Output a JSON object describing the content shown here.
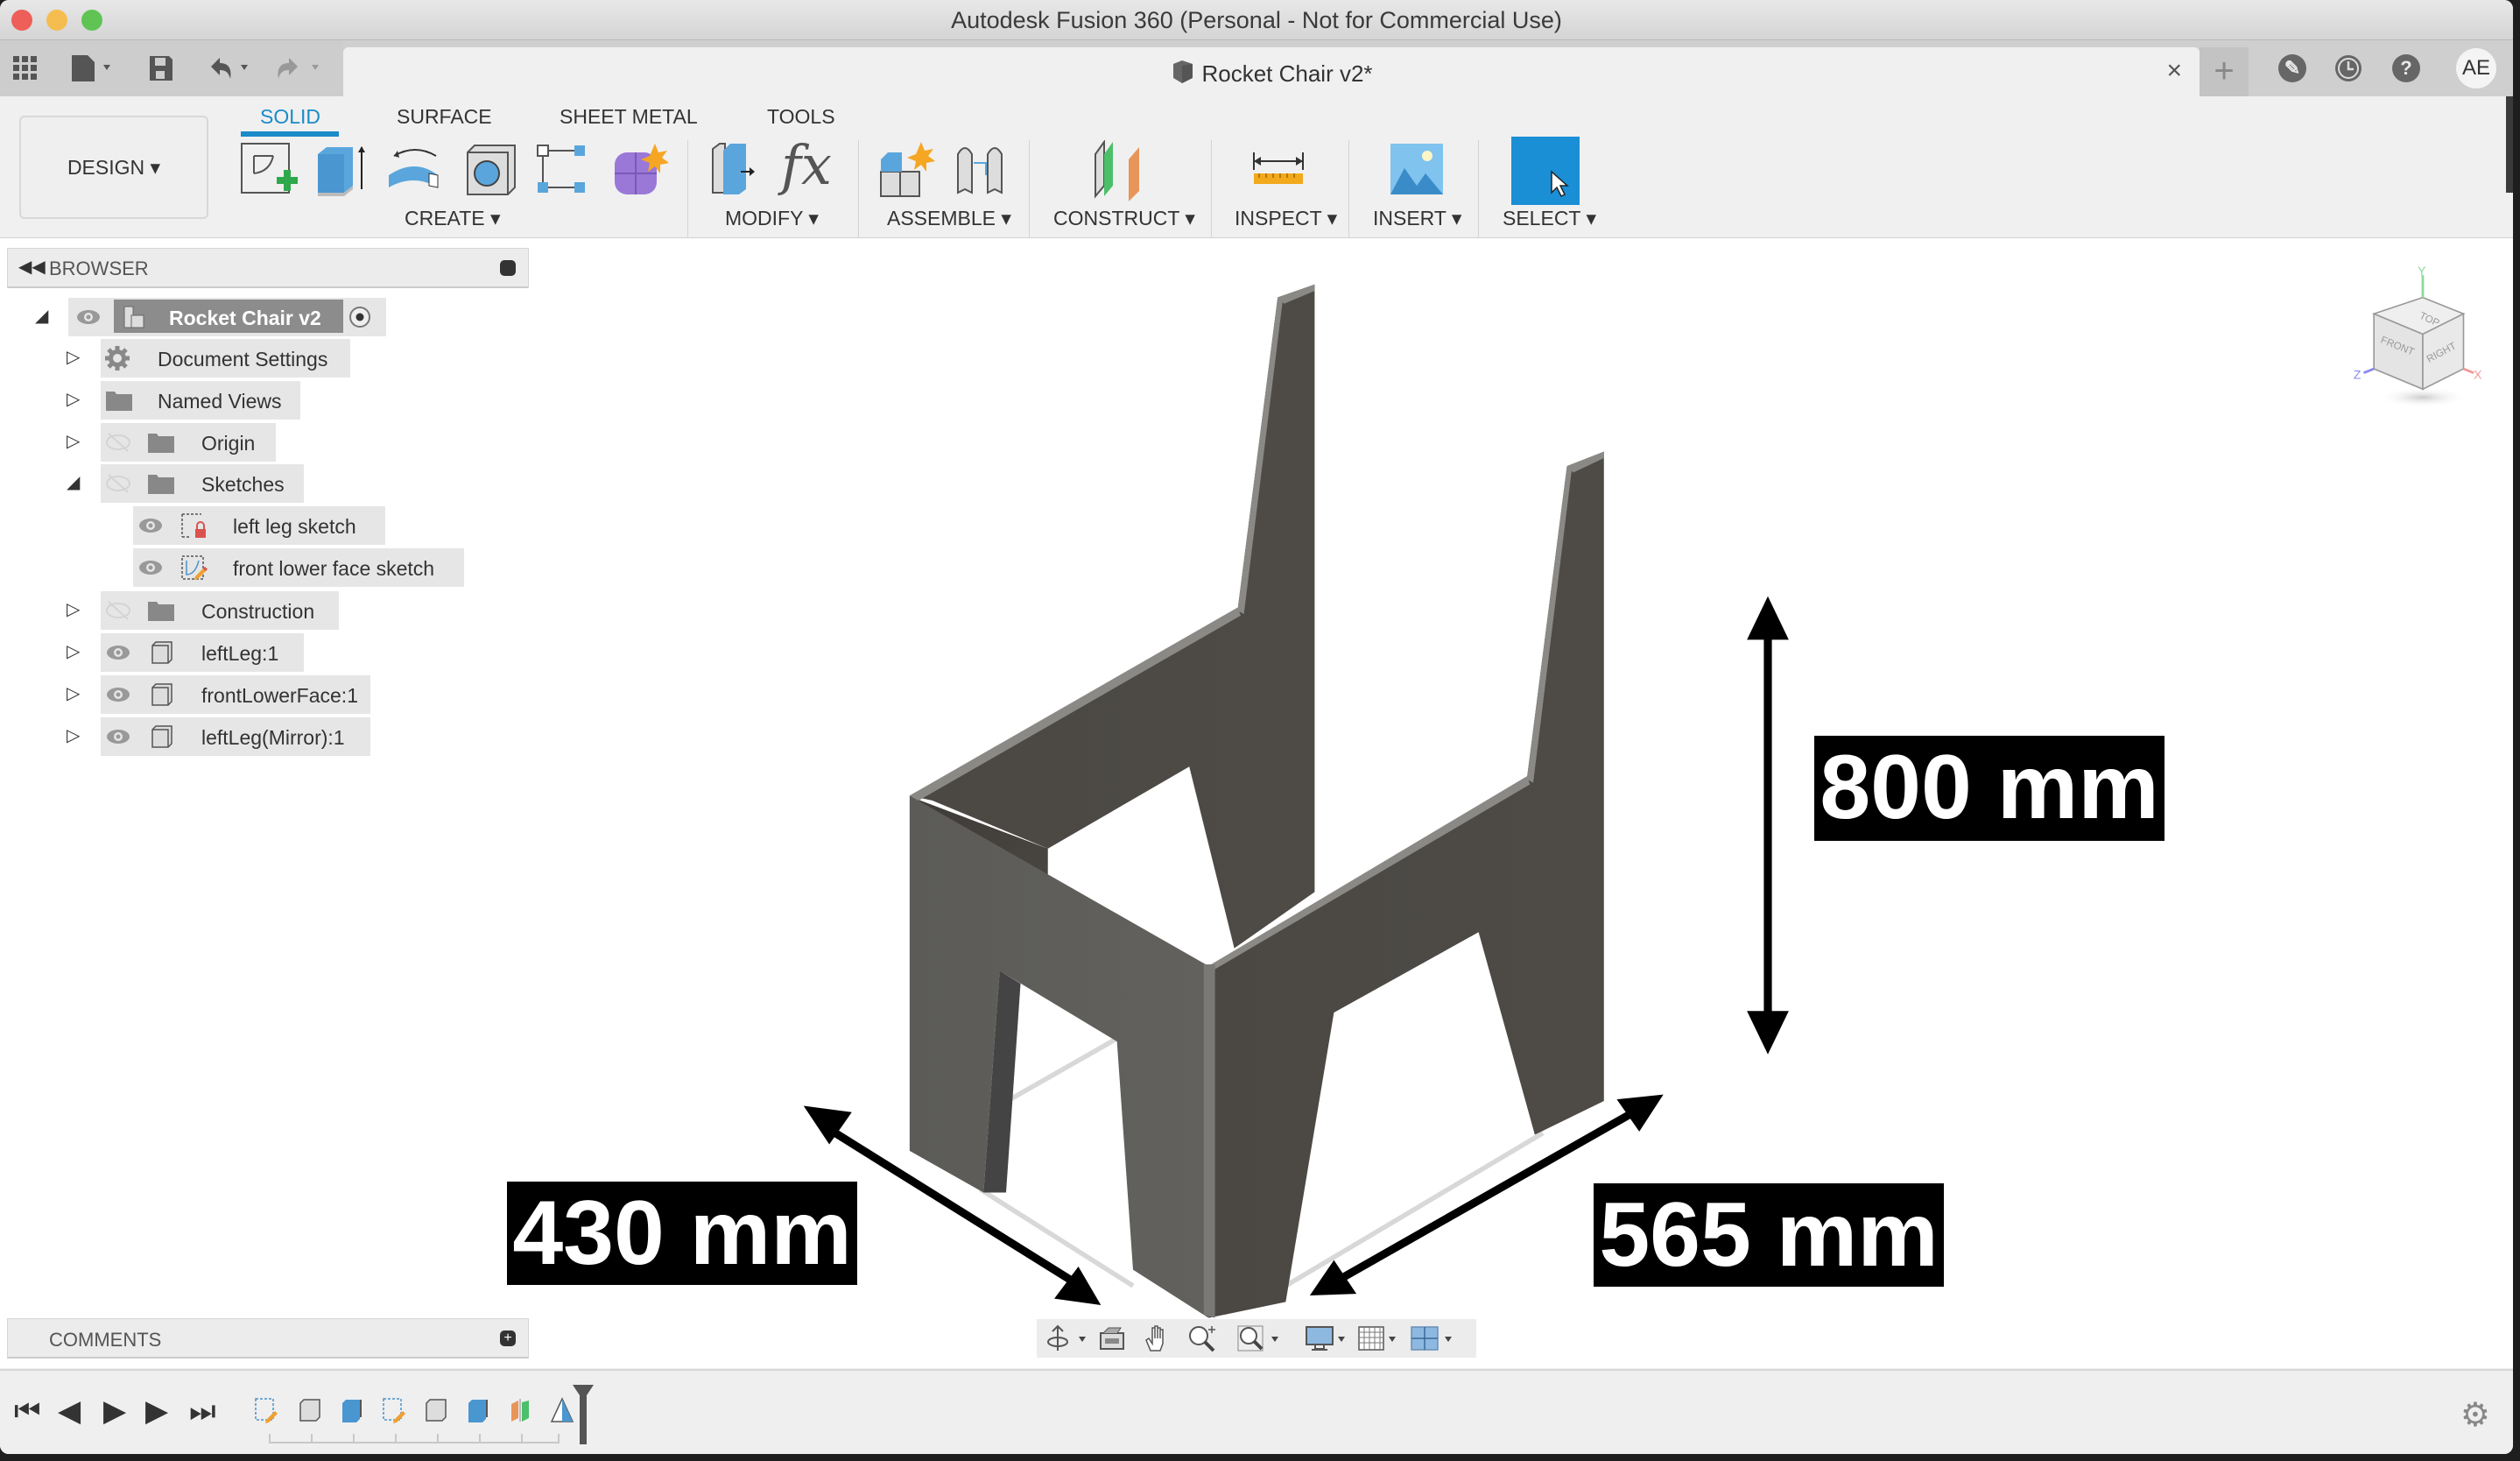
{
  "window": {
    "title": "Autodesk Fusion 360 (Personal - Not for Commercial Use)"
  },
  "quick_toolbar": {
    "icons": [
      "app-grid-icon",
      "file-icon",
      "save-icon",
      "undo-icon",
      "redo-icon"
    ]
  },
  "document_tab": {
    "label": "Rocket Chair v2*",
    "close": "×"
  },
  "top_right": {
    "new_tab": "+",
    "extensions_icon": "wrench-icon",
    "job_status_icon": "clock-icon",
    "help": "?",
    "user_initials": "AE"
  },
  "ribbon": {
    "workspace": "DESIGN ▾",
    "tabs": [
      {
        "label": "SOLID",
        "active": true
      },
      {
        "label": "SURFACE",
        "active": false
      },
      {
        "label": "SHEET METAL",
        "active": false
      },
      {
        "label": "TOOLS",
        "active": false
      }
    ],
    "groups": [
      {
        "label": "CREATE ▾",
        "tools": [
          "create-sketch",
          "extrude",
          "revolve",
          "hole",
          "rectangular-pattern",
          "create-form"
        ]
      },
      {
        "label": "MODIFY ▾",
        "tools": [
          "press-pull",
          "change-parameters"
        ]
      },
      {
        "label": "ASSEMBLE ▾",
        "tools": [
          "new-component",
          "joint"
        ]
      },
      {
        "label": "CONSTRUCT ▾",
        "tools": [
          "offset-plane"
        ]
      },
      {
        "label": "INSPECT ▾",
        "tools": [
          "measure"
        ]
      },
      {
        "label": "INSERT ▾",
        "tools": [
          "insert-image"
        ]
      },
      {
        "label": "SELECT ▾",
        "tools": [
          "select"
        ]
      }
    ],
    "fx_label": "fx"
  },
  "browser": {
    "title": "BROWSER",
    "items": [
      {
        "label": "Rocket Chair v2",
        "expanded": true,
        "visible": true,
        "selected": true,
        "icon": "component-icon"
      },
      {
        "label": "Document Settings",
        "expanded": false,
        "icon": "gear-icon"
      },
      {
        "label": "Named Views",
        "expanded": false,
        "icon": "folder-icon"
      },
      {
        "label": "Origin",
        "expanded": false,
        "visible": false,
        "icon": "folder-icon"
      },
      {
        "label": "Sketches",
        "expanded": true,
        "visible": false,
        "icon": "folder-icon"
      },
      {
        "label": "left leg sketch",
        "visible": true,
        "icon": "sketch-locked-icon"
      },
      {
        "label": "front lower face sketch",
        "visible": true,
        "icon": "sketch-edit-icon"
      },
      {
        "label": "Construction",
        "expanded": false,
        "visible": false,
        "icon": "folder-icon"
      },
      {
        "label": "leftLeg:1",
        "expanded": false,
        "visible": true,
        "icon": "body-icon"
      },
      {
        "label": "frontLowerFace:1",
        "expanded": false,
        "visible": true,
        "icon": "body-icon"
      },
      {
        "label": "leftLeg(Mirror):1",
        "expanded": false,
        "visible": true,
        "icon": "body-icon"
      }
    ]
  },
  "comments": {
    "title": "COMMENTS"
  },
  "viewcube": {
    "faces": [
      "TOP",
      "FRONT",
      "RIGHT"
    ],
    "axes": [
      "Y",
      "Z",
      "X"
    ]
  },
  "dimensions": {
    "height": "800 mm",
    "depth": "430 mm",
    "width": "565 mm"
  },
  "navbar": {
    "tools": [
      "orbit",
      "look-at",
      "pan",
      "zoom",
      "fit",
      "display-settings",
      "grid-snaps",
      "viewports"
    ]
  },
  "timeline": {
    "controls": [
      "first",
      "previous",
      "play",
      "next",
      "last"
    ],
    "features": [
      "sketch",
      "body",
      "extrude",
      "sketch",
      "body",
      "extrude",
      "mirror",
      "plane"
    ]
  },
  "colors": {
    "accent": "#1b8bc9",
    "chair_dark": "#4a4743",
    "chair_light": "#5f5e5a",
    "select_blue": "#1a8fd6"
  }
}
